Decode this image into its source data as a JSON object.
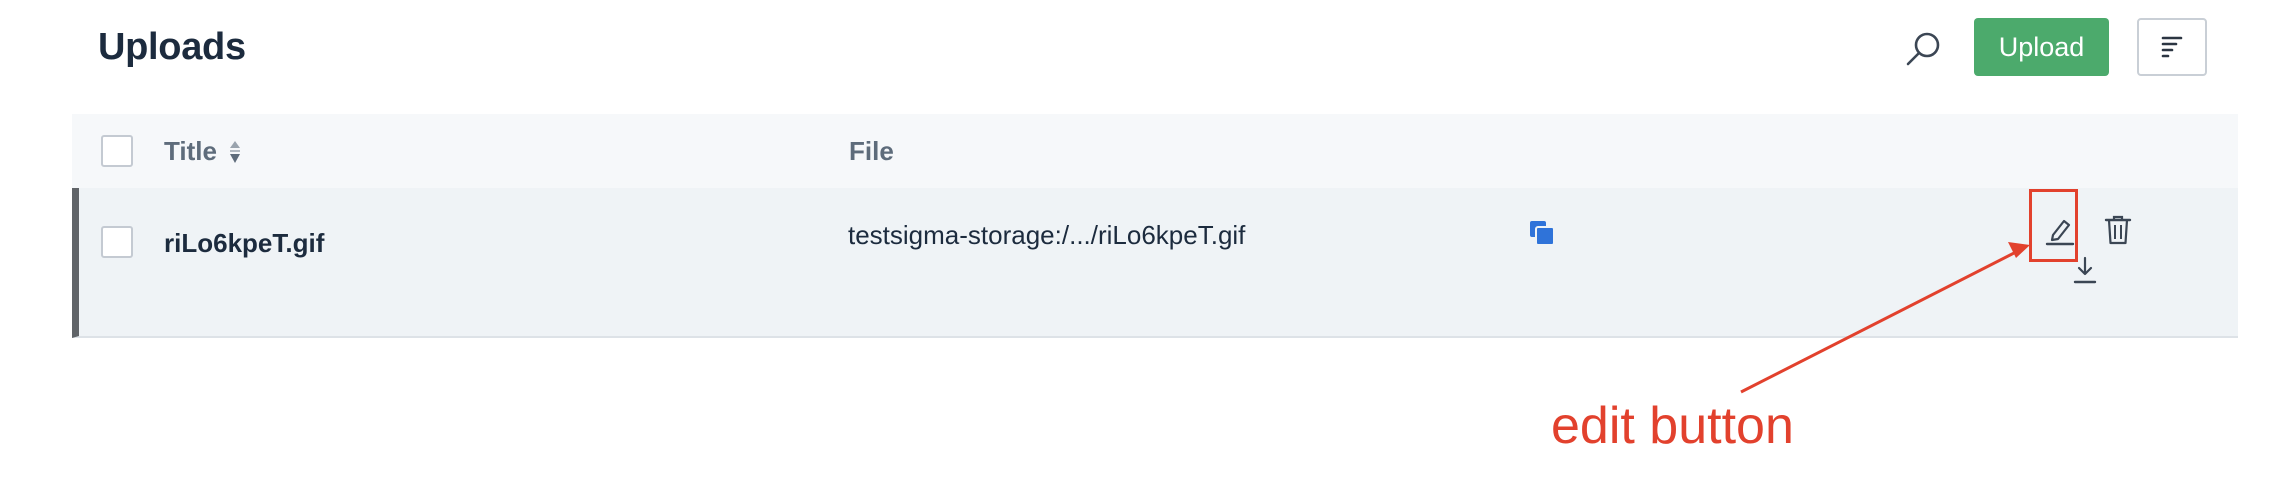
{
  "header": {
    "title": "Uploads",
    "upload_label": "Upload"
  },
  "table": {
    "columns": {
      "title": "Title",
      "file": "File"
    },
    "rows": [
      {
        "title": "riLo6kpeT.gif",
        "file": "testsigma-storage:/.../riLo6kpeT.gif"
      }
    ]
  },
  "annotation": {
    "label": "edit button",
    "color": "#e2412d"
  },
  "colors": {
    "accent": "#4caa6c",
    "link_blue": "#2f73d9"
  },
  "icons": [
    "search-icon",
    "filter-icon",
    "sort-icon",
    "copy-icon",
    "edit-icon",
    "delete-icon",
    "download-icon"
  ]
}
